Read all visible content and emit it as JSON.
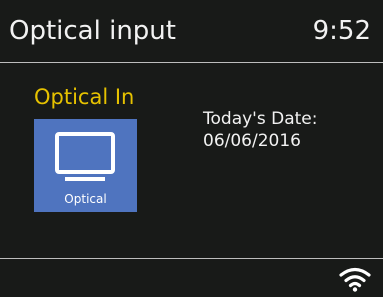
{
  "header": {
    "title": "Optical input",
    "time": "9:52"
  },
  "main": {
    "source_label": "Optical In",
    "tile": {
      "icon": "tv-icon",
      "label": "Optical"
    },
    "date_label": "Today's Date:",
    "date_value": "06/06/2016"
  },
  "status": {
    "wifi_icon": "wifi-icon"
  },
  "colors": {
    "background": "#181a18",
    "accent": "#e6c200",
    "tile": "#4f74bf",
    "text": "#f2f2f2"
  }
}
